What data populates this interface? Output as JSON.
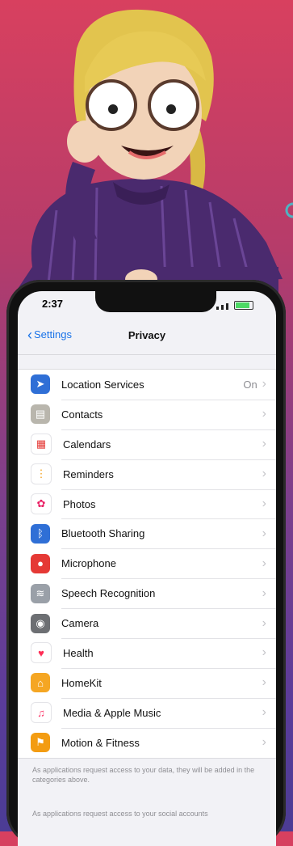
{
  "status_bar": {
    "time": "2:37"
  },
  "nav": {
    "back_label": "Settings",
    "title": "Privacy"
  },
  "privacy_items": [
    {
      "label": "Location Services",
      "value": "On",
      "icon": "location-arrow-icon",
      "color": "#2f6fd6"
    },
    {
      "label": "Contacts",
      "value": "",
      "icon": "contacts-card-icon",
      "color": "#b9b6ad"
    },
    {
      "label": "Calendars",
      "value": "",
      "icon": "calendar-icon",
      "color": "#ffffff"
    },
    {
      "label": "Reminders",
      "value": "",
      "icon": "reminders-list-icon",
      "color": "#ffffff"
    },
    {
      "label": "Photos",
      "value": "",
      "icon": "photos-flower-icon",
      "color": "#ffffff"
    },
    {
      "label": "Bluetooth Sharing",
      "value": "",
      "icon": "bluetooth-icon",
      "color": "#2f6fd6"
    },
    {
      "label": "Microphone",
      "value": "",
      "icon": "microphone-icon",
      "color": "#e53935"
    },
    {
      "label": "Speech Recognition",
      "value": "",
      "icon": "waveform-icon",
      "color": "#9aa0a8"
    },
    {
      "label": "Camera",
      "value": "",
      "icon": "camera-icon",
      "color": "#6d6f73"
    },
    {
      "label": "Health",
      "value": "",
      "icon": "heart-icon",
      "color": "#ffffff"
    },
    {
      "label": "HomeKit",
      "value": "",
      "icon": "home-icon",
      "color": "#f5a623"
    },
    {
      "label": "Media & Apple Music",
      "value": "",
      "icon": "music-note-icon",
      "color": "#ffffff"
    },
    {
      "label": "Motion & Fitness",
      "value": "",
      "icon": "running-icon",
      "color": "#f39c12"
    }
  ],
  "footer": {
    "note_data": "As applications request access to your data, they will be added in the categories above.",
    "note_social": "As applications request access to your social accounts"
  }
}
